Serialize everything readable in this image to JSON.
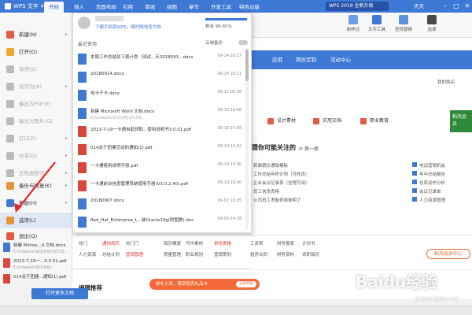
{
  "app": {
    "button_label": "WPS 文字"
  },
  "ribbon_tabs": [
    "开始",
    "插入",
    "页面布局",
    "引用",
    "审阅",
    "视图",
    "章节",
    "开发工具",
    "特色功能"
  ],
  "upgrade_banner": "WPS 2019 全新升级",
  "user_name": "天天",
  "tools": [
    "新样式",
    "文字工具",
    "查找替换",
    "选择"
  ],
  "app_menu": [
    {
      "label": "新建(N)",
      "arrow": "▸",
      "color": "#e25b45"
    },
    {
      "label": "打开(O)",
      "arrow": "",
      "color": "#f0a630"
    },
    {
      "label": "保存(S)",
      "arrow": "",
      "color": "#bbbbbb"
    },
    {
      "label": "另存为(A)",
      "arrow": "▸",
      "color": "#bbbbbb"
    },
    {
      "label": "输出为PDF(F)",
      "arrow": "",
      "color": "#bbbbbb"
    },
    {
      "label": "输出为图片(G)",
      "arrow": "",
      "color": "#bbbbbb"
    },
    {
      "label": "打印(P)",
      "arrow": "▸",
      "color": "#bbbbbb"
    },
    {
      "label": "分享(D)",
      "arrow": "▸",
      "color": "#bbbbbb"
    },
    {
      "label": "文档加密(E)",
      "arrow": "▸",
      "color": "#bbbbbb"
    },
    {
      "label": "备份与恢复(K)",
      "arrow": "▸",
      "color": "#e8933a"
    },
    {
      "label": "帮助(H)",
      "arrow": "▸",
      "color": "#3e79d6"
    },
    {
      "label": "选项(L)",
      "arrow": "",
      "color": "#e8933a"
    },
    {
      "label": "退出(Q)",
      "arrow": "",
      "color": "#e25b45"
    }
  ],
  "account": {
    "sub_link": "下载手机版WPS，随时随地查文档",
    "storage_text": "剩余 99.85%",
    "storage_fraction": 0.98
  },
  "recent": {
    "header": "最近使用",
    "cloud_backup": "云端备份",
    "files": [
      {
        "name": "本周工作总结及下周计划（测试...天2018091...docx",
        "path": "",
        "date": "09-14 16:27",
        "type": "doc"
      },
      {
        "name": "20180914.docx",
        "path": "",
        "date": "09-14 16:21",
        "type": "doc"
      },
      {
        "name": "母卡子卡.docx",
        "path": "",
        "date": "09-11 08:58",
        "type": "doc"
      },
      {
        "name": "新建 Microsoft Word 文档.docx",
        "path": "E:/tcttwork/测试文档/2015年...",
        "date": "09-10 16:58",
        "type": "doc"
      },
      {
        "name": "2013-7-19一卡通自助领取...使用说明书3.0.01.pdf",
        "path": "",
        "date": "09-10 15:58",
        "type": "pdf"
      },
      {
        "name": "014关于团建活动的通知(1).pdf",
        "path": "",
        "date": "09-10 15:02",
        "type": "pdf"
      },
      {
        "name": "一卡通使用说明手册.pdf",
        "path": "",
        "date": "09-10 15:00",
        "type": "pdf"
      },
      {
        "name": "一卡通前台信息管理系统使用手册(V3.0.2.40).pdf",
        "path": "",
        "date": "09-10 15:00",
        "type": "pdf"
      },
      {
        "name": "20180907.docx",
        "path": "",
        "date": "09-07 16:35",
        "type": "doc"
      },
      {
        "name": "Red_Hat_Enterprise_L...装Oracle10g(附图教).doc",
        "path": "",
        "date": "09-05 14:18",
        "type": "doc"
      }
    ]
  },
  "left_recent": [
    {
      "name": "新建 Micros...d 文档.docx",
      "path": "E:/tcttwork/测试文档/2015年...",
      "type": "doc"
    },
    {
      "name": "2013-7-19一...3.0.01.pdf",
      "path": "E:/tcttwork/测试文档/...",
      "type": "pdf"
    },
    {
      "name": "014关于团建...通知(1).pdf",
      "path": "",
      "type": "pdf"
    }
  ],
  "open_more": "打开更多文档",
  "start_page": {
    "nav": [
      "应用",
      "简历定制",
      "活动中心"
    ],
    "my_purchase": "我的购买",
    "chips": [
      "设计素材",
      "实用文档",
      "职业教育"
    ],
    "promo": "稻壳会员",
    "ylike_title": "猜你可能关注的",
    "refresh": "换一换",
    "templates_left": [
      "新面貌交通局模板",
      "工作总结年终计划（可修改）",
      "企业会议记录表（全程可用）",
      "员工信息表格",
      "公司员工考勤表简单明了"
    ],
    "templates_right": [
      "电话营销机会",
      "年中总结报告",
      "仓库运作分析",
      "会议记录单",
      "人力资源管理"
    ],
    "links": [
      {
        "text": "热门",
        "red": false
      },
      {
        "text": "通用简历",
        "red": true
      },
      {
        "text": "热门门",
        "red": false
      },
      {
        "text": "简历模版",
        "red": false
      },
      {
        "text": "写作素材",
        "red": false
      },
      {
        "text": "常用表格",
        "red": true
      },
      {
        "text": "工资表",
        "red": false
      },
      {
        "text": "财务报表",
        "red": false
      },
      {
        "text": "计划书",
        "red": false
      },
      {
        "text": "人力资源",
        "red": false
      },
      {
        "text": "总结计划",
        "red": false
      },
      {
        "text": "营销管理",
        "red": true
      },
      {
        "text": "质量管理",
        "red": false
      },
      {
        "text": "职业规划",
        "red": false
      },
      {
        "text": "营销策划",
        "red": false
      },
      {
        "text": "租房合同",
        "red": false
      },
      {
        "text": "财务资料",
        "red": false
      },
      {
        "text": "求职简历",
        "red": false
      }
    ],
    "member_btn": "稻壳会员中心",
    "editor_title": "编辑推荐",
    "gift_banner": "邮礼小发，尊享稻壳礼品卡",
    "gift_tag": "立即领取"
  },
  "watermark": "Baidu经验",
  "watermark_sub": "jingyan.baidu.com",
  "colors": {
    "brand_blue": "#3e79d6",
    "annotation_red": "#e4262b"
  }
}
